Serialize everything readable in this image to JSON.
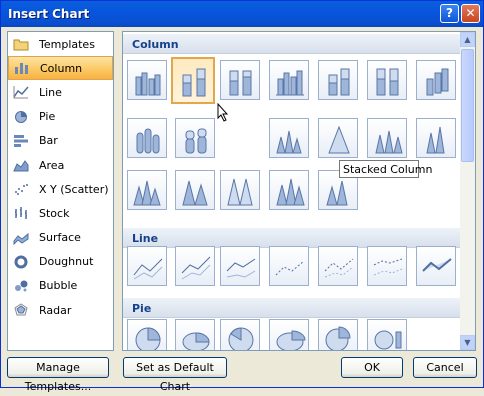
{
  "window": {
    "title": "Insert Chart",
    "help_label": "?",
    "close_label": "✕"
  },
  "sidebar": {
    "items": [
      {
        "label": "Templates",
        "icon": "folder-icon"
      },
      {
        "label": "Column",
        "icon": "column-chart-icon",
        "selected": true
      },
      {
        "label": "Line",
        "icon": "line-chart-icon"
      },
      {
        "label": "Pie",
        "icon": "pie-chart-icon"
      },
      {
        "label": "Bar",
        "icon": "bar-chart-icon"
      },
      {
        "label": "Area",
        "icon": "area-chart-icon"
      },
      {
        "label": "X Y (Scatter)",
        "icon": "scatter-chart-icon"
      },
      {
        "label": "Stock",
        "icon": "stock-chart-icon"
      },
      {
        "label": "Surface",
        "icon": "surface-chart-icon"
      },
      {
        "label": "Doughnut",
        "icon": "doughnut-chart-icon"
      },
      {
        "label": "Bubble",
        "icon": "bubble-chart-icon"
      },
      {
        "label": "Radar",
        "icon": "radar-chart-icon"
      }
    ]
  },
  "gallery": {
    "sections": [
      {
        "title": "Column"
      },
      {
        "title": "Line"
      },
      {
        "title": "Pie"
      }
    ],
    "tooltip": "Stacked Column"
  },
  "buttons": {
    "manage": "Manage Templates...",
    "set_default": "Set as Default Chart",
    "ok": "OK",
    "cancel": "Cancel"
  },
  "colors": {
    "titlebar": "#0a5fdb",
    "selection": "#fbc760",
    "section_header_text": "#15428b"
  }
}
